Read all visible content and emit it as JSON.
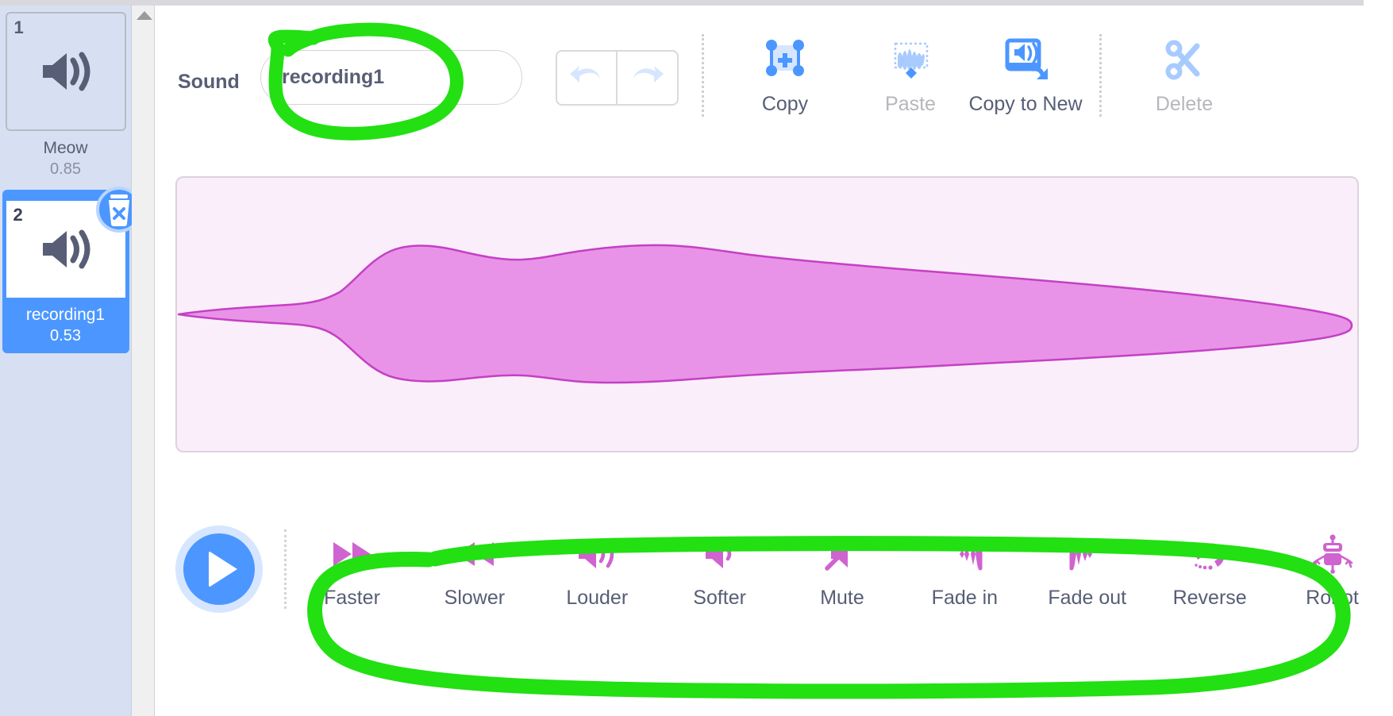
{
  "app": {
    "accent_blue": "#4c97ff",
    "effect_pink": "#cf63cf",
    "annotation_color": "#22e012",
    "waveform_fill": "#e893e8",
    "waveform_stroke": "#c440c4",
    "waveform_bg": "#fbeefb"
  },
  "sidebar": {
    "sounds": [
      {
        "index": "1",
        "name": "Meow",
        "duration": "0.85",
        "selected": false,
        "icon": "speaker-icon"
      },
      {
        "index": "2",
        "name": "recording1",
        "duration": "0.53",
        "selected": true,
        "icon": "speaker-icon",
        "delete_badge_icon": "trash-delete-icon"
      }
    ],
    "scroll_up_icon": "scroll-up-arrow-icon"
  },
  "header": {
    "sound_label": "Sound",
    "name_value": "recording1",
    "name_placeholder": "",
    "undo_icon": "undo-arrow-icon",
    "redo_icon": "redo-arrow-icon",
    "tools": [
      {
        "label": "Copy",
        "icon": "copy-selection-icon",
        "enabled": true
      },
      {
        "label": "Paste",
        "icon": "paste-waveform-icon",
        "enabled": false
      },
      {
        "label": "Copy to New",
        "icon": "copy-to-new-sound-icon",
        "enabled": true
      },
      {
        "label": "Delete",
        "icon": "scissors-delete-icon",
        "enabled": false
      }
    ]
  },
  "editor": {
    "play_button_label": "play",
    "play_icon": "play-triangle-icon"
  },
  "effects": [
    {
      "label": "Faster",
      "icon": "fast-forward-icon"
    },
    {
      "label": "Slower",
      "icon": "rewind-icon"
    },
    {
      "label": "Louder",
      "icon": "volume-up-icon"
    },
    {
      "label": "Softer",
      "icon": "volume-down-icon"
    },
    {
      "label": "Mute",
      "icon": "volume-mute-icon"
    },
    {
      "label": "Fade in",
      "icon": "fade-in-icon"
    },
    {
      "label": "Fade out",
      "icon": "fade-out-icon"
    },
    {
      "label": "Reverse",
      "icon": "reverse-arrow-icon"
    },
    {
      "label": "Robot",
      "icon": "robot-icon"
    }
  ],
  "annotations": [
    {
      "name": "circle-around-sound-name",
      "shape": "hand-drawn-oval"
    },
    {
      "name": "oval-around-effects-row",
      "shape": "hand-drawn-oval"
    }
  ]
}
